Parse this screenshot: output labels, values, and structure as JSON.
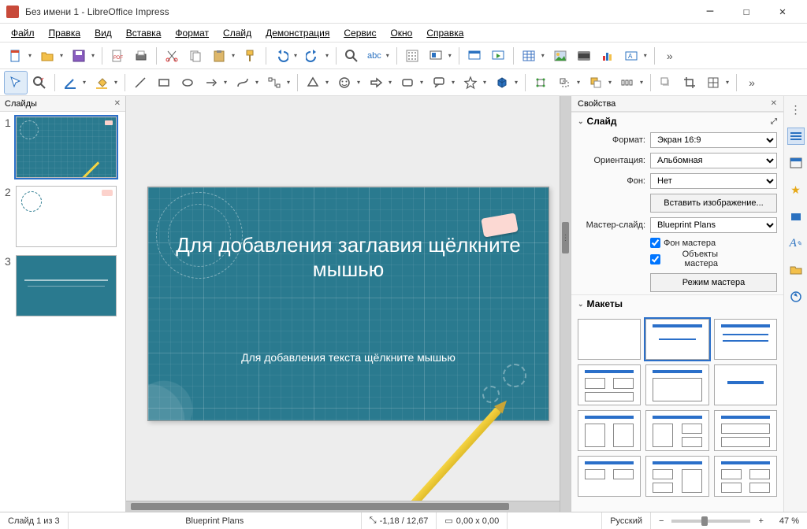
{
  "window": {
    "title": "Без имени 1 - LibreOffice Impress"
  },
  "menu": {
    "file": "Файл",
    "edit": "Правка",
    "view": "Вид",
    "insert": "Вставка",
    "format": "Формат",
    "slide": "Слайд",
    "slideshow": "Демонстрация",
    "tools": "Сервис",
    "window": "Окно",
    "help": "Справка"
  },
  "panels": {
    "slides_header": "Слайды",
    "properties_header": "Свойства"
  },
  "slides": [
    {
      "num": "1"
    },
    {
      "num": "2"
    },
    {
      "num": "3"
    }
  ],
  "editor_slide": {
    "title_placeholder": "Для добавления заглавия щёлкните мышью",
    "text_placeholder": "Для добавления текста щёлкните мышью"
  },
  "props": {
    "slide_section": "Слайд",
    "format_label": "Формат:",
    "format_value": "Экран 16:9",
    "orientation_label": "Ориентация:",
    "orientation_value": "Альбомная",
    "background_label": "Фон:",
    "background_value": "Нет",
    "insert_image_btn": "Вставить изображение...",
    "master_label": "Мастер-слайд:",
    "master_value": "Blueprint Plans",
    "master_bg_chk": "Фон мастера",
    "master_obj_chk": "Объекты мастера",
    "master_mode_btn": "Режим мастера",
    "layouts_section": "Макеты"
  },
  "status": {
    "slide_count": "Слайд 1 из 3",
    "master_name": "Blueprint Plans",
    "pos": "-1,18 / 12,67",
    "size": "0,00 x 0,00",
    "lang": "Русский",
    "zoom": "47 %"
  },
  "icons": {
    "new": "new-document",
    "open": "folder-open",
    "save": "floppy",
    "pdf": "export-pdf",
    "print": "printer",
    "cut": "scissors",
    "copy": "copy",
    "paste": "clipboard",
    "clone": "brush",
    "undo": "undo",
    "redo": "redo",
    "find": "magnifier",
    "spell": "abc-check",
    "grid": "grid",
    "table": "table"
  }
}
